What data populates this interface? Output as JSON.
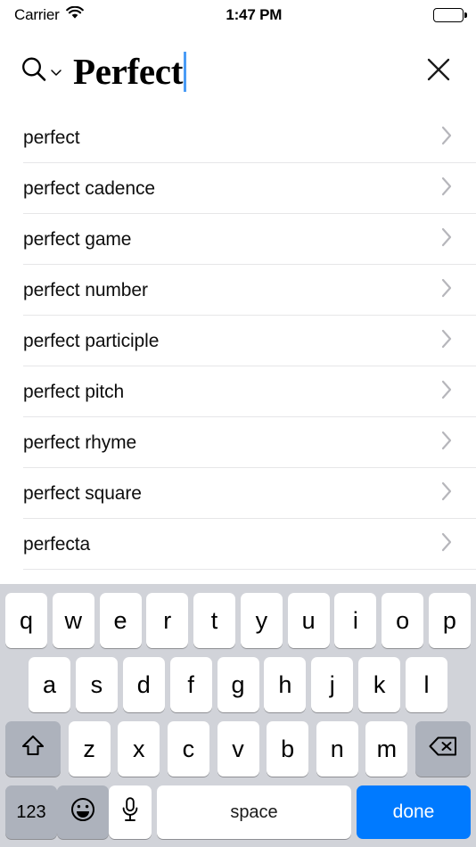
{
  "status_bar": {
    "carrier": "Carrier",
    "wifi_icon": "wifi-icon",
    "time": "1:47 PM",
    "battery_icon": "battery-full-icon"
  },
  "search_header": {
    "search_icon": "search-magnifier-icon",
    "dropdown_icon": "chevron-down-icon",
    "query": "Perfect",
    "caret_color": "#4a9cf6",
    "clear_icon": "close-x-icon"
  },
  "suggestions": {
    "disclosure_icon": "chevron-right-icon",
    "items": [
      {
        "label": "perfect"
      },
      {
        "label": "perfect cadence"
      },
      {
        "label": "perfect game"
      },
      {
        "label": "perfect number"
      },
      {
        "label": "perfect participle"
      },
      {
        "label": "perfect pitch"
      },
      {
        "label": "perfect rhyme"
      },
      {
        "label": "perfect square"
      },
      {
        "label": "perfecta"
      }
    ]
  },
  "keyboard": {
    "background_color": "#d1d3d9",
    "row1": [
      "q",
      "w",
      "e",
      "r",
      "t",
      "y",
      "u",
      "i",
      "o",
      "p"
    ],
    "row2": [
      "a",
      "s",
      "d",
      "f",
      "g",
      "h",
      "j",
      "k",
      "l"
    ],
    "row3": [
      "z",
      "x",
      "c",
      "v",
      "b",
      "n",
      "m"
    ],
    "shift_icon": "shift-arrow-icon",
    "delete_icon": "backspace-delete-icon",
    "numbers_label": "123",
    "emoji_icon": "emoji-smiley-icon",
    "mic_icon": "microphone-icon",
    "space_label": "space",
    "done_label": "done",
    "done_color": "#007aff"
  }
}
